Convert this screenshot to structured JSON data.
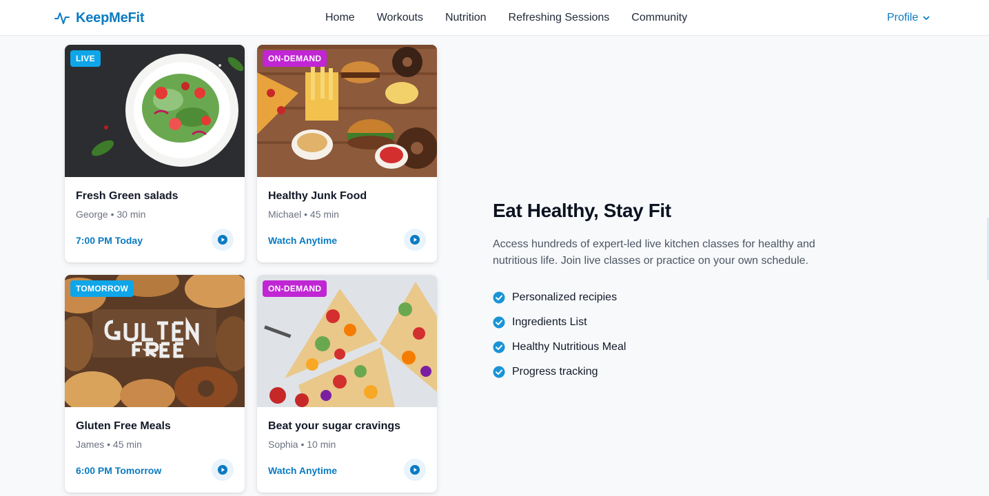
{
  "brand": {
    "name": "KeepMeFit",
    "logo_icon": "pulse-icon"
  },
  "nav": {
    "items": [
      "Home",
      "Workouts",
      "Nutrition",
      "Refreshing Sessions",
      "Community"
    ],
    "profile_label": "Profile"
  },
  "colors": {
    "accent": "#0a7bc2",
    "live_badge": "#0ea5e9",
    "ondemand_badge": "#c026d3",
    "tomorrow_badge": "#0ea5e9"
  },
  "cards": [
    {
      "badge": "LIVE",
      "title": "Fresh Green salads",
      "meta": "George • 30 min",
      "time": "7:00 PM Today",
      "image": "salad-bowl-photo"
    },
    {
      "badge": "ON-DEMAND",
      "title": "Healthy Junk Food",
      "meta": "Michael • 45 min",
      "time": "Watch Anytime",
      "image": "junk-food-spread-photo"
    },
    {
      "badge": "TOMORROW",
      "title": "Gluten Free Meals",
      "meta": "James • 45 min",
      "time": "6:00 PM Tomorrow",
      "image": "gluten-free-bread-photo"
    },
    {
      "badge": "ON-DEMAND",
      "title": "Beat your sugar cravings",
      "meta": "Sophia • 10 min",
      "time": "Watch Anytime",
      "image": "fruit-tart-photo"
    }
  ],
  "hero": {
    "title": "Eat Healthy, Stay Fit",
    "description": "Access hundreds of expert-led live kitchen classes for healthy and nutritious life. Join live classes or practice on your own schedule.",
    "features": [
      "Personalized recipies",
      "Ingredients List",
      "Healthy Nutritious Meal",
      "Progress tracking"
    ]
  }
}
